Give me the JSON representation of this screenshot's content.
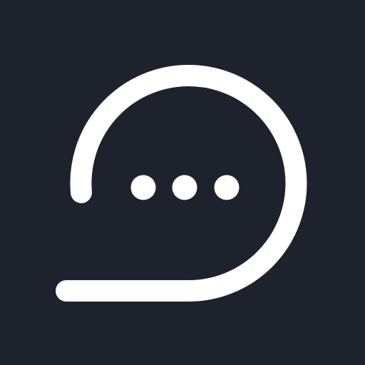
{
  "icon": {
    "name": "chat-bubble-typing-icon",
    "background_color": "#1d222c",
    "foreground_color": "#ffffff",
    "typing_dots_count": 3
  }
}
